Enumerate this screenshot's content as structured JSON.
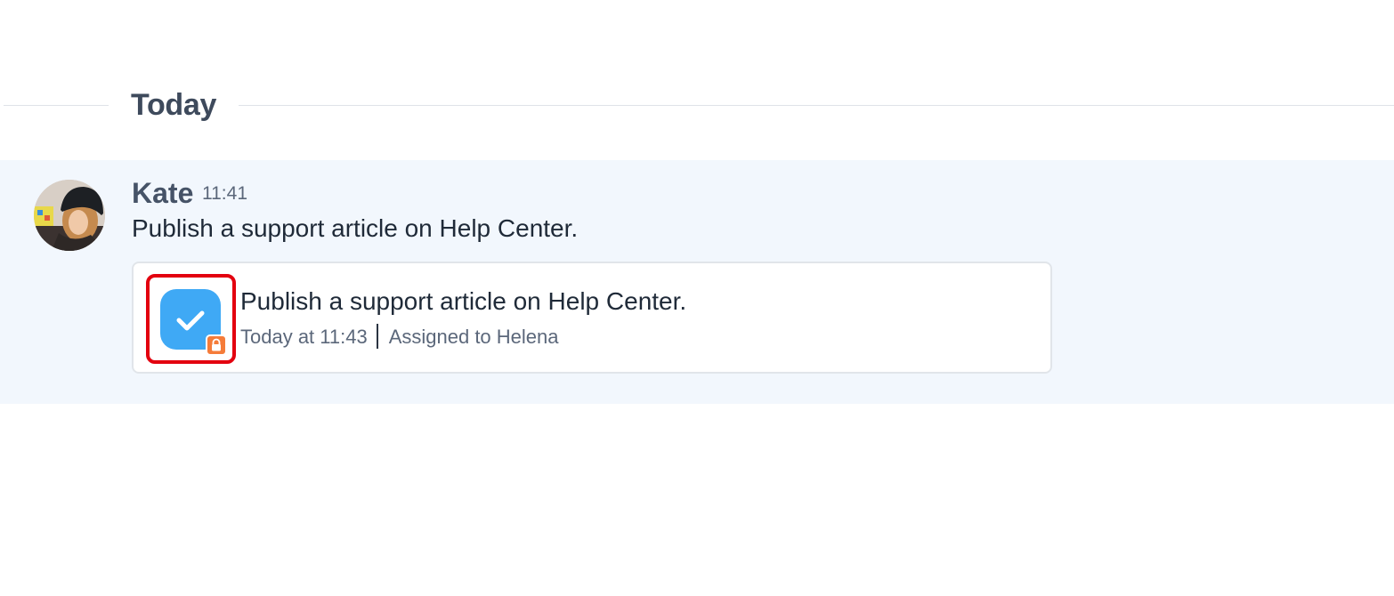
{
  "date_separator": {
    "label": "Today"
  },
  "message": {
    "author": "Kate",
    "time": "11:41",
    "text": "Publish a support article on Help Center.",
    "avatar_icon": "user-avatar-photo",
    "task_card": {
      "title": "Publish a support article on Help Center.",
      "due": "Today at 11:43",
      "assignee": "Assigned to Helena",
      "icon": "checkmark-icon",
      "badge_icon": "lock-icon",
      "colors": {
        "task_icon": "#3fa9f5",
        "lock_badge": "#f57c3a",
        "highlight_border": "#e3000f"
      }
    }
  },
  "colors": {
    "message_background": "#f2f7fd",
    "separator_line": "#dfe3e8"
  }
}
